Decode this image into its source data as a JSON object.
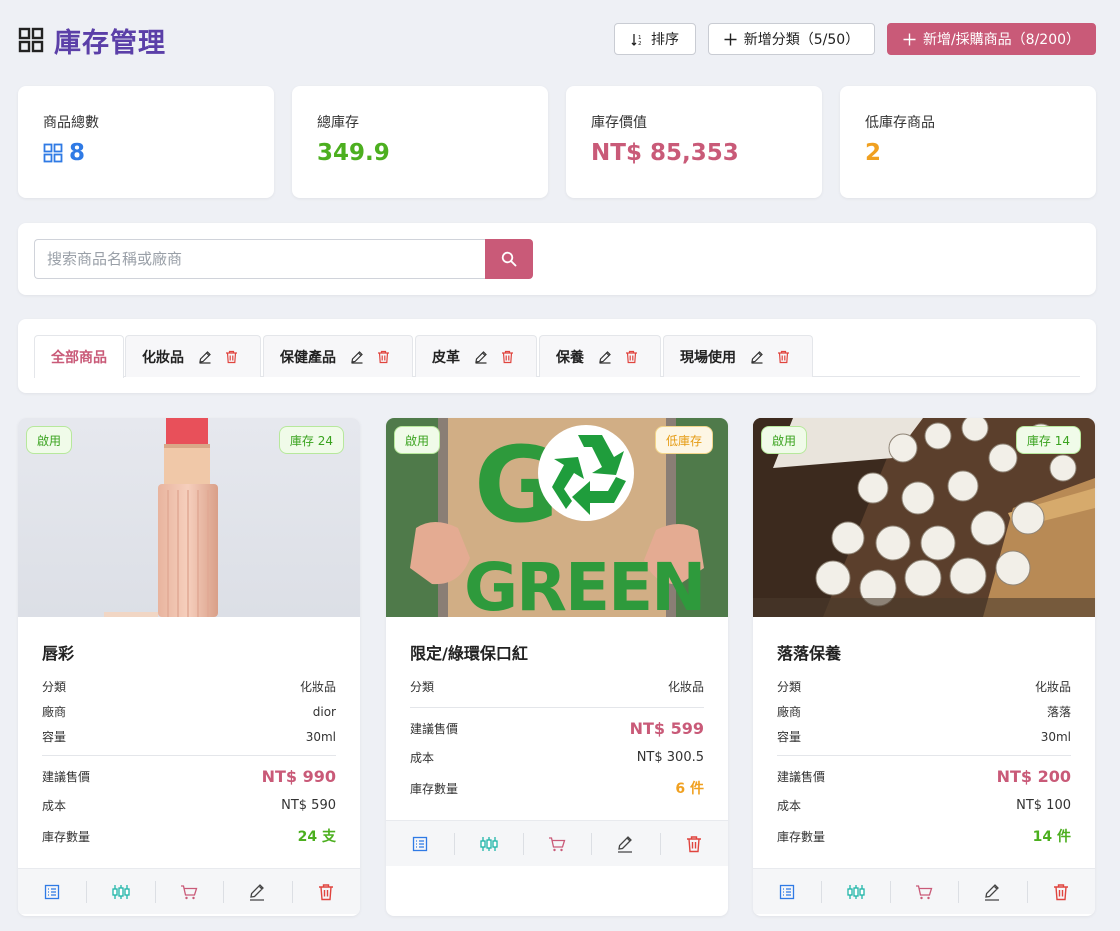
{
  "header": {
    "title": "庫存管理",
    "sort_label": "排序",
    "add_category_label": "新增分類（5/50）",
    "add_product_label": "新增/採購商品（8/200）"
  },
  "stats": [
    {
      "label": "商品總數",
      "value": "8",
      "color": "#2f7ae5"
    },
    {
      "label": "總庫存",
      "value": "349.9",
      "color": "#4caf1f"
    },
    {
      "label": "庫存價值",
      "value": "NT$ 85,353",
      "color": "#c95a78"
    },
    {
      "label": "低庫存商品",
      "value": "2",
      "color": "#f0a020"
    }
  ],
  "search": {
    "placeholder": "搜索商品名稱或廠商",
    "value": ""
  },
  "tabs": [
    {
      "label": "全部商品",
      "active": true
    },
    {
      "label": "化妝品"
    },
    {
      "label": "保健產品"
    },
    {
      "label": "皮革"
    },
    {
      "label": "保養"
    },
    {
      "label": "現場使用"
    }
  ],
  "products": [
    {
      "name": "唇彩",
      "status_badge": "啟用",
      "stock_badge": "庫存 24",
      "stock_badge_type": "green",
      "image_icon": "lipstick-image",
      "info": [
        {
          "label": "分類",
          "value": "化妝品"
        },
        {
          "label": "廠商",
          "value": "dior"
        },
        {
          "label": "容量",
          "value": "30ml"
        }
      ],
      "price_label": "建議售價",
      "price": "NT$ 990",
      "cost_label": "成本",
      "cost": "NT$ 590",
      "stock_label": "庫存數量",
      "stock": "24 支",
      "stock_color": "#4caf1f"
    },
    {
      "name": "限定/綠環保口紅",
      "status_badge": "啟用",
      "stock_badge": "低庫存",
      "stock_badge_type": "orange",
      "image_icon": "go-green-image",
      "image_text_top": "G",
      "image_text_bottom": "GREEN",
      "info": [
        {
          "label": "分類",
          "value": "化妝品"
        }
      ],
      "price_label": "建議售價",
      "price": "NT$ 599",
      "cost_label": "成本",
      "cost": "NT$ 300.5",
      "stock_label": "庫存數量",
      "stock": "6 件",
      "stock_color": "#f0a020"
    },
    {
      "name": "落落保養",
      "status_badge": "啟用",
      "stock_badge": "庫存 14",
      "stock_badge_type": "green",
      "image_icon": "jars-image",
      "info": [
        {
          "label": "分類",
          "value": "化妝品"
        },
        {
          "label": "廠商",
          "value": "落落"
        },
        {
          "label": "容量",
          "value": "30ml"
        }
      ],
      "price_label": "建議售價",
      "price": "NT$ 200",
      "cost_label": "成本",
      "cost": "NT$ 100",
      "stock_label": "庫存數量",
      "stock": "14 件",
      "stock_color": "#4caf1f"
    }
  ],
  "action_icons": [
    "list-icon",
    "adjust-stock-icon",
    "cart-icon",
    "edit-icon",
    "delete-icon"
  ],
  "colors": {
    "accent": "#c95a78",
    "title": "#5b3fa8",
    "blue": "#2f7ae5",
    "teal": "#1fb5a8",
    "red": "#e0443e"
  }
}
